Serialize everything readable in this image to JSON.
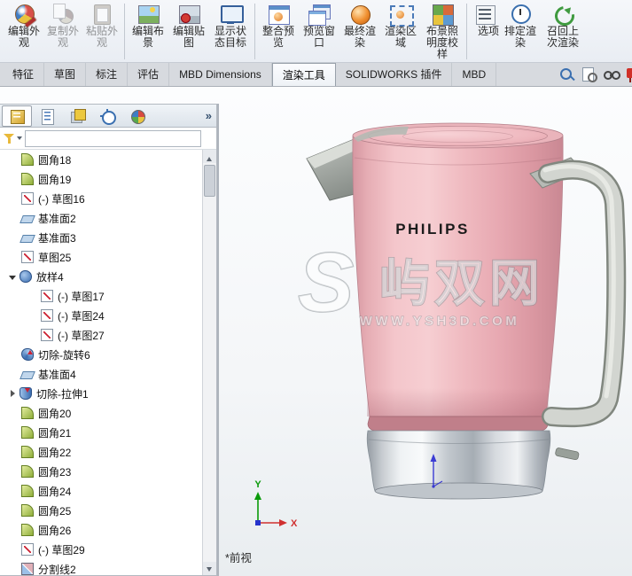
{
  "ribbon": {
    "buttons": [
      {
        "label": "编辑外观",
        "disabled": false
      },
      {
        "label": "复制外观",
        "disabled": true
      },
      {
        "label": "粘贴外观",
        "disabled": true
      },
      {
        "label": "编辑布景",
        "disabled": false
      },
      {
        "label": "编辑贴图",
        "disabled": false
      },
      {
        "label": "显示状态目标",
        "disabled": false
      },
      {
        "label": "整合预览",
        "disabled": false
      },
      {
        "label": "预览窗口",
        "disabled": false
      },
      {
        "label": "最终渲染",
        "disabled": false
      },
      {
        "label": "渲染区域",
        "disabled": false
      },
      {
        "label": "布景照明度校样",
        "disabled": false
      },
      {
        "label": "选项",
        "disabled": false
      },
      {
        "label": "排定渲染",
        "disabled": false
      },
      {
        "label": "召回上次渲染",
        "disabled": false
      }
    ]
  },
  "tabbar": {
    "tabs": [
      {
        "label": "特征",
        "active": false
      },
      {
        "label": "草图",
        "active": false
      },
      {
        "label": "标注",
        "active": false
      },
      {
        "label": "评估",
        "active": false
      },
      {
        "label": "MBD Dimensions",
        "active": false
      },
      {
        "label": "渲染工具",
        "active": true
      },
      {
        "label": "SOLIDWORKS 插件",
        "active": false
      },
      {
        "label": "MBD",
        "active": false
      }
    ]
  },
  "panel": {
    "expand_icon": "»",
    "tree": {
      "items": [
        {
          "label": "圆角18",
          "type": "fillet"
        },
        {
          "label": "圆角19",
          "type": "fillet"
        },
        {
          "label": "(-) 草图16",
          "type": "sketch"
        },
        {
          "label": "基准面2",
          "type": "plane"
        },
        {
          "label": "基准面3",
          "type": "plane"
        },
        {
          "label": "草图25",
          "type": "sketch"
        },
        {
          "label": "放样4",
          "type": "loft",
          "expanded": true
        },
        {
          "label": "(-) 草图17",
          "type": "sketch",
          "child": true
        },
        {
          "label": "(-) 草图24",
          "type": "sketch",
          "child": true
        },
        {
          "label": "(-) 草图27",
          "type": "sketch",
          "child": true
        },
        {
          "label": "切除-旋转6",
          "type": "revolve-cut"
        },
        {
          "label": "基准面4",
          "type": "plane"
        },
        {
          "label": "切除-拉伸1",
          "type": "extrude-cut",
          "collapsed": true
        },
        {
          "label": "圆角20",
          "type": "fillet"
        },
        {
          "label": "圆角21",
          "type": "fillet"
        },
        {
          "label": "圆角22",
          "type": "fillet"
        },
        {
          "label": "圆角23",
          "type": "fillet"
        },
        {
          "label": "圆角24",
          "type": "fillet"
        },
        {
          "label": "圆角25",
          "type": "fillet"
        },
        {
          "label": "圆角26",
          "type": "fillet"
        },
        {
          "label": "(-) 草图29",
          "type": "sketch"
        },
        {
          "label": "分割线2",
          "type": "splitline"
        }
      ]
    }
  },
  "viewport": {
    "brand": "PHILIPS",
    "view_label": "*前视",
    "watermark": {
      "logo": "S",
      "title": "屿双网",
      "url": "WWW.YSH3D.COM"
    },
    "triad": {
      "x": "X",
      "y": "Y"
    }
  },
  "colors": {
    "kettle_pink": "#f0bbc1",
    "accent_blue": "#3a6fb0"
  }
}
